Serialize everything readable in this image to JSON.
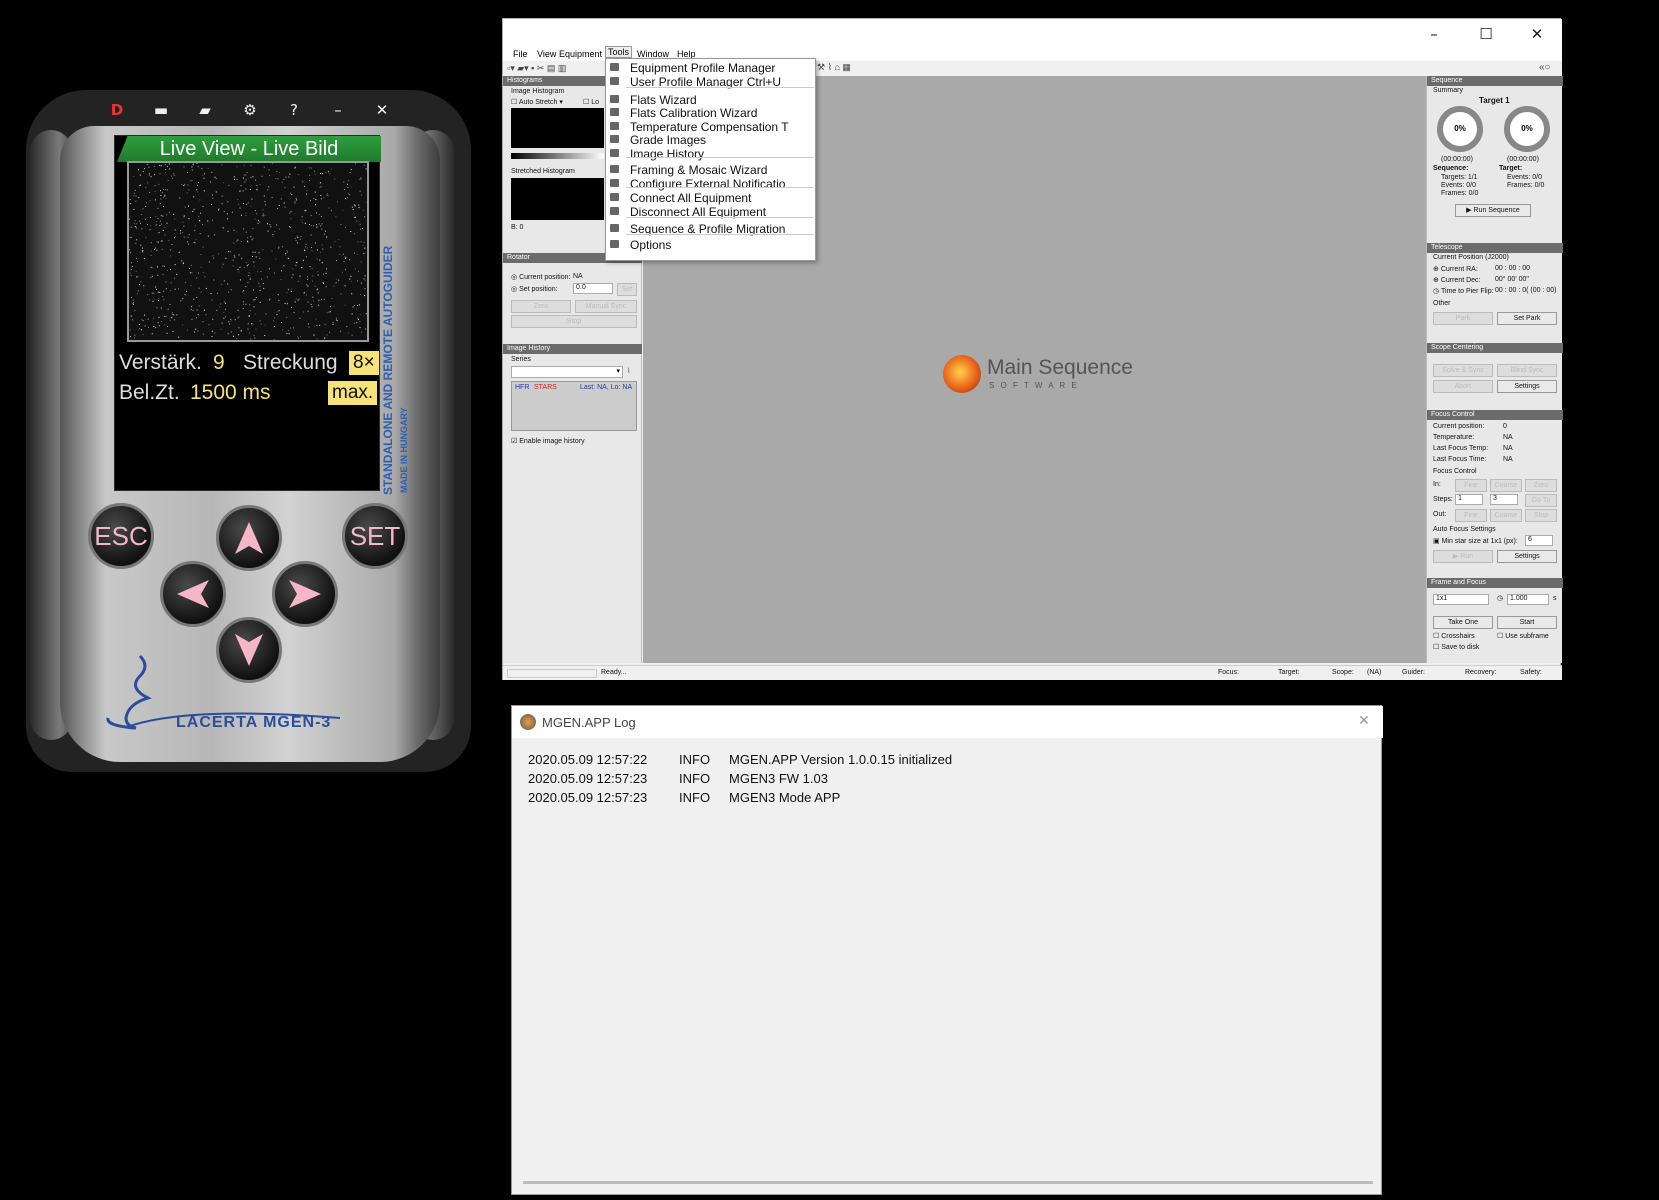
{
  "mgen": {
    "toolbar": {
      "d_label": "D",
      "help_label": "?",
      "minimize_label": "–",
      "close_label": "✕"
    },
    "live_view_title": "Live View - Live Bild",
    "gain_label": "Verstärk.",
    "gain_value": "9",
    "stretch_label": "Streckung",
    "stretch_value": "8×",
    "exposure_label": "Bel.Zt.",
    "exposure_value": "1500 ms",
    "exposure_mode": "max.",
    "side_text_1": "STANDALONE AND REMOTE AUTOGUIDER",
    "side_text_2": "MADE IN HUNGARY",
    "buttons": {
      "esc": "ESC",
      "set": "SET"
    },
    "brand_logo": "LACERTA MGEN-3"
  },
  "nina": {
    "menu": {
      "file": "File",
      "view": "View",
      "equipment": "Equipment",
      "tools": "Tools",
      "window": "Window",
      "help": "Help"
    },
    "tools_menu": [
      "Equipment Profile Manager",
      "User Profile Manager   Ctrl+U",
      "Flats Wizard",
      "Flats Calibration Wizard",
      "Temperature Compensation T",
      "Grade Images",
      "Image History",
      "Framing & Mosaic Wizard",
      "Configure External Notificatio",
      "Connect All Equipment",
      "Disconnect All Equipment",
      "Sequence & Profile Migration",
      "Options"
    ],
    "histograms": {
      "title": "Histograms",
      "image_histogram": "Image Histogram",
      "auto_stretch": "Auto Stretch",
      "lo": "Lo",
      "stretched": "Stretched Histogram",
      "b": "B: 0"
    },
    "rotator": {
      "title": "Rotator",
      "current_label": "Current position:",
      "current_value": "NA",
      "set_label": "Set position:",
      "set_value": "0.0",
      "set_btn": "Set",
      "zero": "Zero",
      "manual_sync": "Manual Sync",
      "stop": "Stop"
    },
    "image_history": {
      "title": "Image History",
      "series": "Series",
      "hfr": "HFR",
      "stars": "STARS",
      "last": "Last: NA, Lo: NA",
      "enable": "Enable image history"
    },
    "center_logo": {
      "line1": "Main Sequence",
      "line2": "S O F T W A R E"
    },
    "sequence": {
      "title": "Sequence",
      "summary": "Summary",
      "target": "Target 1",
      "pct1": "0%",
      "pct2": "0%",
      "time1": "(00:00:00)",
      "time2": "(00:00:00)",
      "seq_label": "Sequence:",
      "tgt_label": "Target:",
      "targets": "Targets:  1/1",
      "events": "Events:  0/0",
      "frames": "Frames:  0/0",
      "events2": "Events:  0/0",
      "frames2": "Frames:  0/0",
      "run": "Run Sequence"
    },
    "telescope": {
      "title": "Telescope",
      "current_pos": "Current Position (J2000)",
      "ra_label": "Current RA:",
      "ra_value": "00 : 00 : 00",
      "dec_label": "Current Dec:",
      "dec_value": "00°  00'  00\"",
      "pier_label": "Time to Pier Flip:",
      "pier_value": "00 : 00 : 0( (00 : 00)",
      "other": "Other",
      "park": "Park",
      "set_park": "Set Park"
    },
    "scope_centering": {
      "title": "Scope Centering",
      "solve_sync": "Solve & Sync",
      "blind_sync": "Blind Sync",
      "abort": "Abort",
      "settings": "Settings"
    },
    "focus": {
      "title": "Focus Control",
      "pos_label": "Current position:",
      "pos_value": "0",
      "temp_label": "Temperature:",
      "temp_value": "NA",
      "lft_label": "Last Focus Temp:",
      "lft_value": "NA",
      "lfti_label": "Last Focus Time:",
      "lfti_value": "NA",
      "fc": "Focus Control",
      "in": "In:",
      "fine": "Fine",
      "coarse": "Coarse",
      "zero": "Zero",
      "steps": "Steps:",
      "s1": "1",
      "s2": "3",
      "goto": "Go To",
      "out": "Out:",
      "stop": "Stop",
      "af": "Auto Focus Settings",
      "minstar": "Min star size at 1x1 (px):",
      "minstar_value": "6",
      "run": "Run",
      "settings": "Settings"
    },
    "frame_focus": {
      "title": "Frame and Focus",
      "binning": "1x1",
      "exposure": "1.000",
      "unit": "s",
      "take_one": "Take One",
      "start": "Start",
      "crosshairs": "Crosshairs",
      "subframe": "Use subframe",
      "save": "Save to disk"
    },
    "status": {
      "ready": "Ready...",
      "focus": "Focus:",
      "target": "Target:",
      "scope": "Scope:",
      "scope_val": "(NA)",
      "guider": "Guider:",
      "recovery": "Recovery:",
      "safety": "Safety:"
    }
  },
  "log": {
    "title": "MGEN.APP Log",
    "rows": [
      {
        "time": "2020.05.09 12:57:22",
        "level": "INFO",
        "msg": "MGEN.APP Version 1.0.0.15 initialized"
      },
      {
        "time": "2020.05.09 12:57:23",
        "level": "INFO",
        "msg": "MGEN3 FW 1.03"
      },
      {
        "time": "2020.05.09 12:57:23",
        "level": "INFO",
        "msg": "MGEN3 Mode APP"
      }
    ]
  },
  "colors": {
    "accent_green": "#2e9e3e",
    "value_yellow": "#f6e27a",
    "button_pink": "#f4b6c8",
    "brand_blue": "#2b4e9a"
  }
}
